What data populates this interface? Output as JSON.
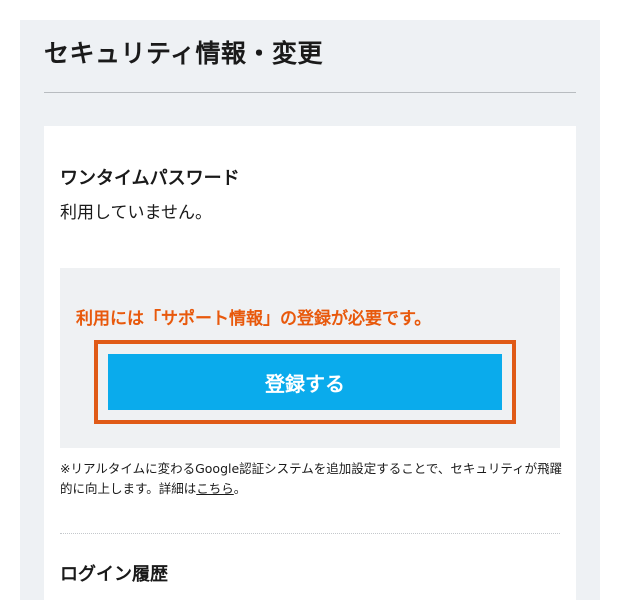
{
  "page": {
    "title": "セキュリティ情報・変更"
  },
  "one_time_password": {
    "heading": "ワンタイムパスワード",
    "status": "利用していません。",
    "notice": "利用には「サポート情報」の登録が必要です。",
    "register_button_label": "登録する",
    "footnote_text": "※リアルタイムに変わるGoogle認証システムを追加設定することで、セキュリティが飛躍的に向上します。詳細は",
    "footnote_link": "こちら",
    "footnote_end": "。"
  },
  "login_history": {
    "heading": "ログイン履歴"
  },
  "colors": {
    "accent_button": "#0aabec",
    "notice_text": "#e8590c",
    "highlight_frame": "#e05a17",
    "page_background": "#eef1f4"
  }
}
